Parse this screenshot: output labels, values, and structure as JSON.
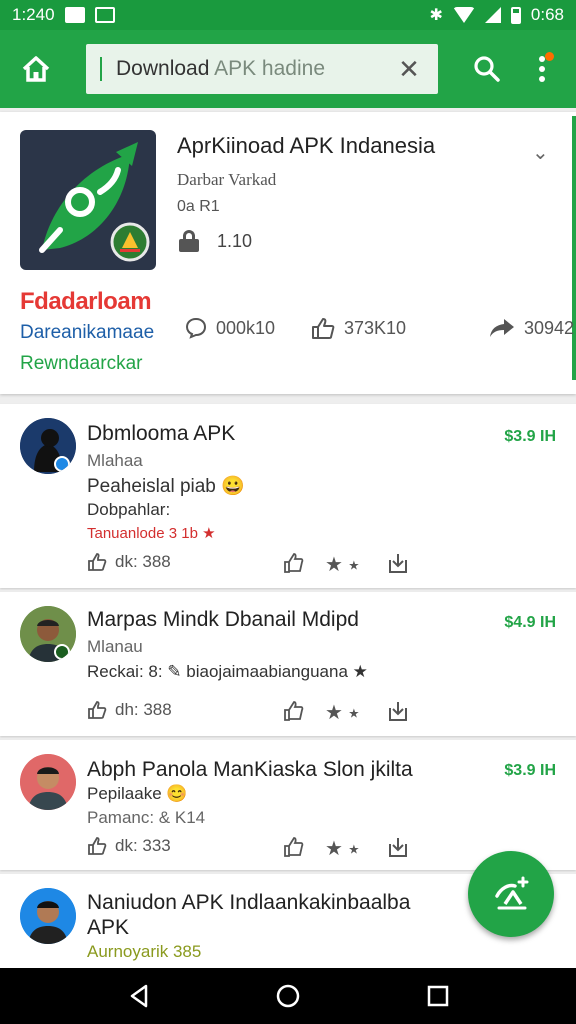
{
  "status_bar": {
    "time": "1:240",
    "right_time": "0:68"
  },
  "toolbar": {
    "search_value_main": "Download ",
    "search_value_dim": "APK hadine",
    "clear_label": "✕"
  },
  "app": {
    "title": "AprKiinoad APK Indanesia",
    "developer": "Darbar Varkad",
    "version": "0a R1",
    "size": "1.10",
    "brand_label": "Fdadarloam",
    "sub_label": "Dareanikamaae",
    "green_label": "Rewndaarckar",
    "stats": {
      "comments": "000k10",
      "likes": "373K10",
      "shares": "30942"
    }
  },
  "feed": [
    {
      "title": "Dbmlooma APK",
      "lines": [
        "Mlahaa",
        "Peaheislal piab 😀",
        "Dobpahlar:",
        "Tanuanlode 3 1b ★"
      ],
      "price": "$3.9 IH",
      "likes": "dk: 388"
    },
    {
      "title": "Marpas Mindk Dbanail Mdipd",
      "lines": [
        "Mlanau",
        "Reckai: 8: ✎ biaojaimaabianguana ★"
      ],
      "price": "$4.9 IH",
      "likes": "dh: 388"
    },
    {
      "title": "Abph Panola ManKiaska Slon jkilta",
      "lines": [
        "Pepilaake 😊",
        "Pamanc: & K14"
      ],
      "price": "$3.9 IH",
      "likes": "dk: 333"
    },
    {
      "title": "Naniudon APK Indlaankakinbaalba APK",
      "lines": [
        "Aurnoyarik 385"
      ],
      "price": ""
    }
  ],
  "colors": {
    "brand_green": "#22a447",
    "status_green": "#1a9a3e",
    "accent_red": "#e53935",
    "link_blue": "#1e5fa8"
  },
  "icons": [
    "home-icon",
    "search-icon",
    "more-vert-icon",
    "clear-icon",
    "chevron-down-icon",
    "lock-icon",
    "comment-icon",
    "like-icon",
    "share-icon",
    "thumb-up-icon",
    "star-icon",
    "save-icon",
    "fab-icon",
    "back-icon",
    "home-nav-icon",
    "recents-icon"
  ]
}
